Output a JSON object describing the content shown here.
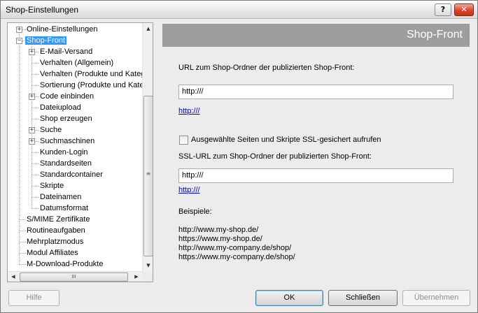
{
  "window": {
    "title": "Shop-Einstellungen"
  },
  "titlebar": {
    "help_glyph": "?",
    "close_glyph": "✕"
  },
  "tree": {
    "items": [
      {
        "label": "Online-Einstellungen"
      },
      {
        "label": "Shop-Front"
      },
      {
        "label": "E-Mail-Versand"
      },
      {
        "label": "Verhalten (Allgemein)"
      },
      {
        "label": "Verhalten (Produkte und Kateg"
      },
      {
        "label": "Sortierung (Produkte und Kateg"
      },
      {
        "label": "Code einbinden"
      },
      {
        "label": "Dateiupload"
      },
      {
        "label": "Shop erzeugen"
      },
      {
        "label": "Suche"
      },
      {
        "label": "Suchmaschinen"
      },
      {
        "label": "Kunden-Login"
      },
      {
        "label": "Standardseiten"
      },
      {
        "label": "Standardcontainer"
      },
      {
        "label": "Skripte"
      },
      {
        "label": "Dateinamen"
      },
      {
        "label": "Datumsformat"
      },
      {
        "label": "S/MIME Zertifikate"
      },
      {
        "label": "Routineaufgaben"
      },
      {
        "label": "Mehrplatzmodus"
      },
      {
        "label": "Modul Affiliates"
      },
      {
        "label": "M-Download-Produkte"
      }
    ],
    "plus": "+",
    "minus": "−"
  },
  "scroll": {
    "up": "▲",
    "down": "▼",
    "left": "◀",
    "right": "▶",
    "grip": "≡",
    "hgrip": "III"
  },
  "panel": {
    "header": "Shop-Front",
    "url_label": "URL zum Shop-Ordner der publizierten Shop-Front:",
    "url_value": "http:///",
    "url_link": "http:///",
    "ssl_checkbox_label": "Ausgewählte Seiten und Skripte SSL-gesichert aufrufen",
    "ssl_url_label": "SSL-URL zum Shop-Ordner der publizierten Shop-Front:",
    "ssl_url_value": "http:///",
    "ssl_url_link": "http:///",
    "examples_label": "Beispiele:",
    "examples": [
      "http://www.my-shop.de/",
      "https://www.my-shop.de/",
      "http://www.my-company.de/shop/",
      "https://www.my-company.de/shop/"
    ]
  },
  "buttons": {
    "help": "Hilfe",
    "ok": "OK",
    "close": "Schließen",
    "apply": "Übernehmen"
  }
}
